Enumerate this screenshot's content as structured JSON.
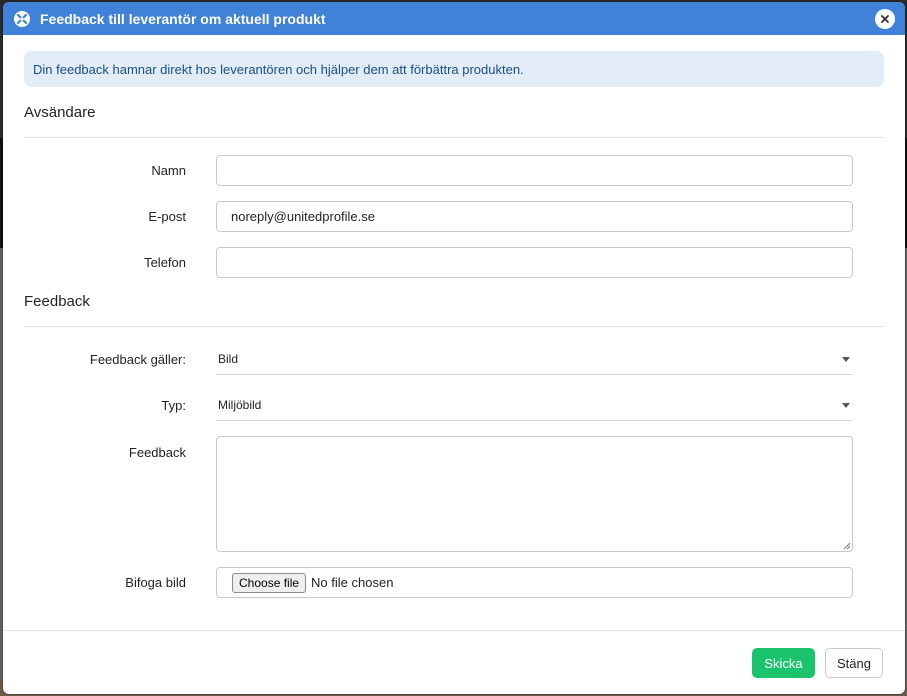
{
  "dialog": {
    "title": "Feedback till leverantör om aktuell produkt",
    "title_icon": "app-logo-icon",
    "close_icon": "close-icon"
  },
  "info_message": "Din feedback hamnar direkt hos leverantören och hjälper dem att förbättra produkten.",
  "sender": {
    "section_title": "Avsändare",
    "name_label": "Namn",
    "name_value": "",
    "email_label": "E-post",
    "email_value": "noreply@unitedprofile.se",
    "phone_label": "Telefon",
    "phone_value": ""
  },
  "feedback": {
    "section_title": "Feedback",
    "subject_label": "Feedback gäller:",
    "subject_value": "Bild",
    "type_label": "Typ:",
    "type_value": "Miljöbild",
    "text_label": "Feedback",
    "text_value": "",
    "attach_label": "Bifoga bild",
    "choose_file_label": "Choose file",
    "no_file_text": "No file chosen"
  },
  "footer": {
    "send_label": "Skicka",
    "close_label": "Stäng"
  },
  "colors": {
    "header": "#3f82d8",
    "info_bg": "#e1ecf6",
    "send_button": "#1cc36d"
  }
}
